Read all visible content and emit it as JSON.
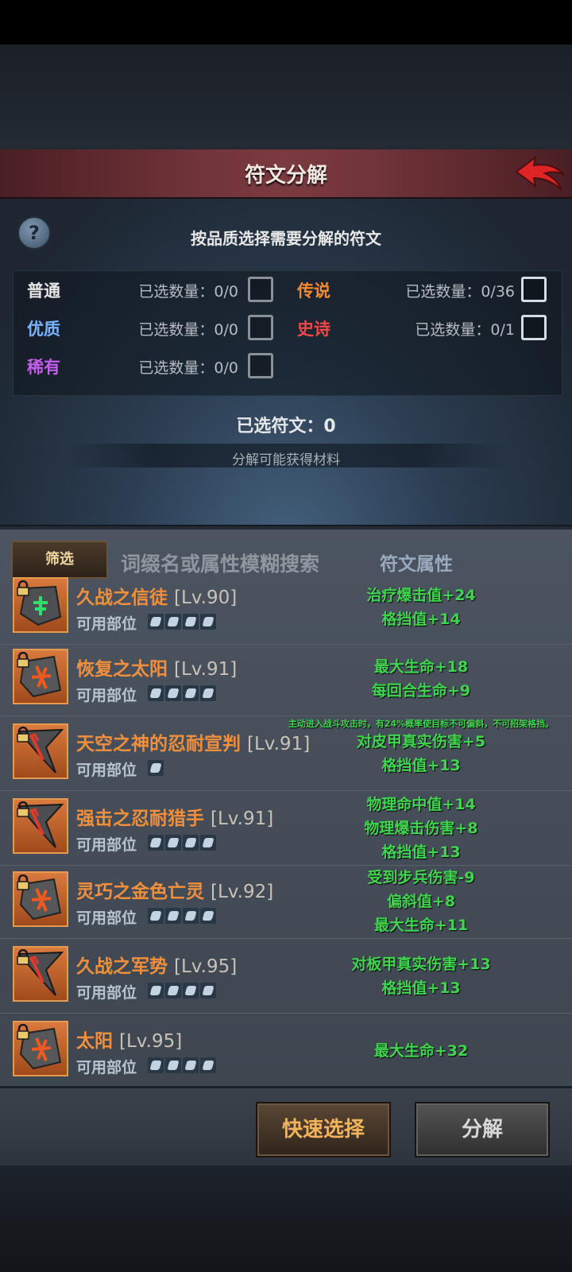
{
  "header": {
    "title": "符文分解"
  },
  "help": {
    "symbol": "?"
  },
  "instruction": "按品质选择需要分解的符文",
  "qualities": [
    {
      "name": "普通",
      "count": "已选数量：0/0",
      "color": "#e6e6e6"
    },
    {
      "name": "优质",
      "count": "已选数量：0/0",
      "color": "#78b4ff"
    },
    {
      "name": "稀有",
      "count": "已选数量：0/0",
      "color": "#c45cf0"
    },
    {
      "name": "传说",
      "count": "已选数量：0/36",
      "color": "#f58a2e"
    },
    {
      "name": "史诗",
      "count": "已选数量：0/1",
      "color": "#f04848"
    }
  ],
  "selected_runes": "已选符文：0",
  "materials_label": "分解可能获得材料",
  "filter": {
    "button_label": "筛选",
    "search_placeholder": "词缀名或属性模糊搜索",
    "attr_header": "符文属性"
  },
  "slot_label": "可用部位",
  "runes": [
    {
      "name": "久战之信徒",
      "level": "[Lv.90]",
      "icon": "green-rune-icon",
      "attrs": [
        "治疗爆击值+24",
        "格挡值+14"
      ]
    },
    {
      "name": "恢复之太阳",
      "level": "[Lv.91]",
      "icon": "orange-rune-icon",
      "attrs": [
        "最大生命+18",
        "每回合生命+9"
      ]
    },
    {
      "name": "天空之神的忍耐宣判",
      "level": "[Lv.91]",
      "icon": "blade-rune-icon",
      "special": "主动进入战斗攻击时，有24%概率使目标不可偏斜，不可招架格挡。",
      "attrs": [
        "对皮甲真实伤害+5",
        "格挡值+13"
      ]
    },
    {
      "name": "强击之忍耐猎手",
      "level": "[Lv.91]",
      "icon": "blade-rune-icon",
      "attrs": [
        "物理命中值+14",
        "物理爆击伤害+8",
        "格挡值+13"
      ]
    },
    {
      "name": "灵巧之金色亡灵",
      "level": "[Lv.92]",
      "icon": "orange-rune-icon",
      "attrs": [
        "受到步兵伤害-9",
        "偏斜值+8",
        "最大生命+11"
      ]
    },
    {
      "name": "久战之军势",
      "level": "[Lv.95]",
      "icon": "blade-rune-icon",
      "attrs": [
        "对板甲真实伤害+13",
        "格挡值+13"
      ]
    },
    {
      "name": "太阳",
      "level": "[Lv.95]",
      "icon": "orange-rune-icon",
      "attrs": [
        "最大生命+32"
      ]
    }
  ],
  "buttons": {
    "quick_select": "快速选择",
    "decompose": "分解"
  }
}
